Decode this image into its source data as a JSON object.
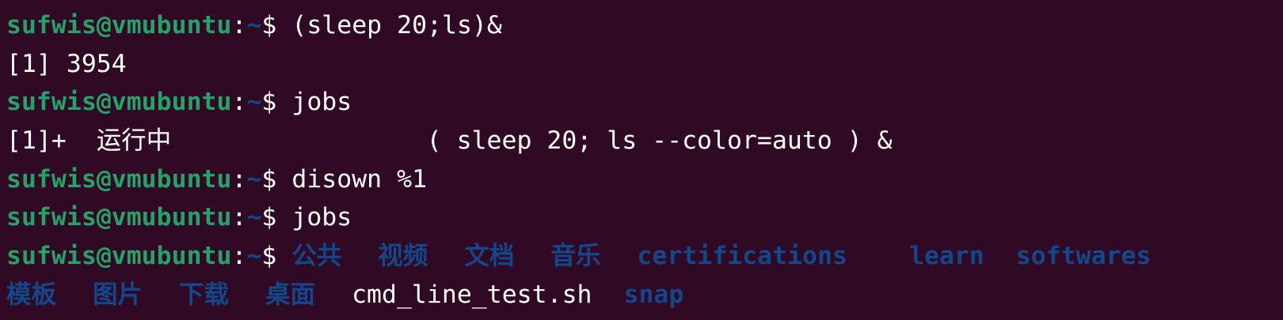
{
  "terminal": {
    "prompt": {
      "user_host": "sufwis@vmubuntu",
      "colon": ":",
      "path": "~",
      "dollar": "$ "
    },
    "colors": {
      "background": "#300a24",
      "prompt_green": "#26a269",
      "dir_blue": "#12488b",
      "text": "#ffffff"
    },
    "lines": [
      {
        "type": "prompt",
        "command": "(sleep 20;ls)&"
      },
      {
        "type": "output",
        "text": "[1] 3954"
      },
      {
        "type": "prompt",
        "command": "jobs"
      },
      {
        "type": "output",
        "text": "[1]+  运行中                 ( sleep 20; ls --color=auto ) &"
      },
      {
        "type": "prompt",
        "command": "disown %1"
      },
      {
        "type": "prompt",
        "command": "jobs"
      }
    ],
    "ls_output": {
      "row1": [
        "公共",
        "视频",
        "文档",
        "音乐",
        "certifications",
        "learn",
        "softwares"
      ],
      "row2_dirs_a": [
        "模板",
        "图片",
        "下载",
        "桌面"
      ],
      "row2_file": "cmd_line_test.sh",
      "row2_dirs_b": [
        "snap"
      ]
    }
  }
}
